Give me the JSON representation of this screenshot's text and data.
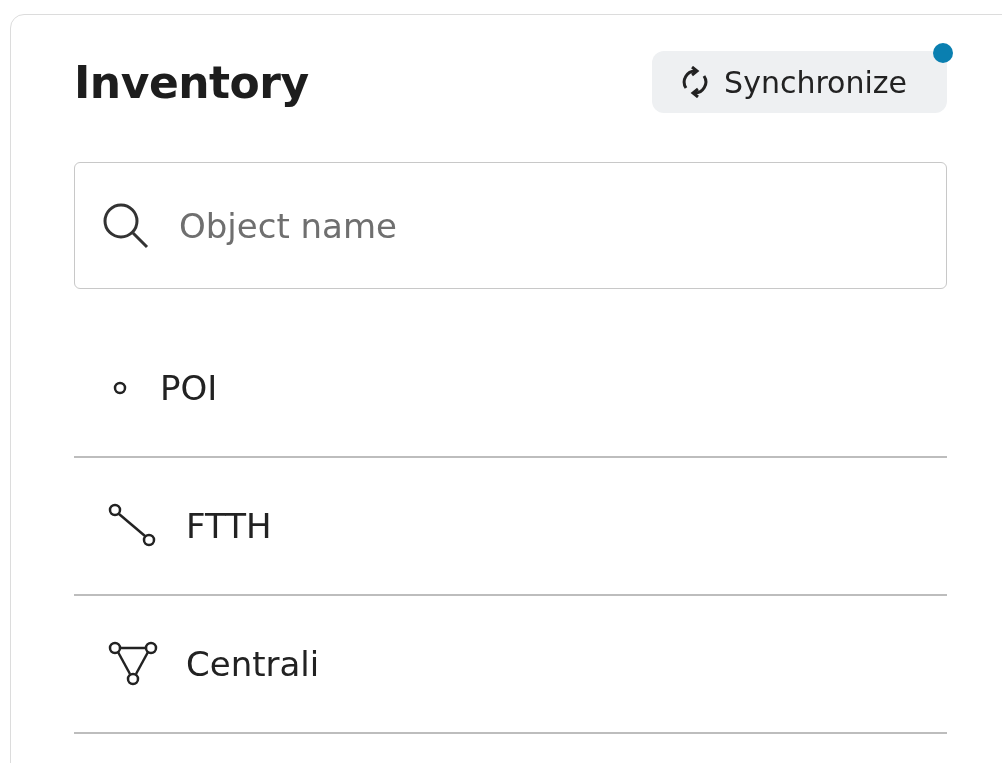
{
  "panel": {
    "title": "Inventory",
    "sync_button": {
      "label": "Synchronize",
      "notification": true
    },
    "search": {
      "placeholder": "Object name"
    },
    "items": [
      {
        "kind": "point",
        "label": "POI"
      },
      {
        "kind": "line",
        "label": "FTTH"
      },
      {
        "kind": "network",
        "label": "Centrali"
      }
    ]
  }
}
